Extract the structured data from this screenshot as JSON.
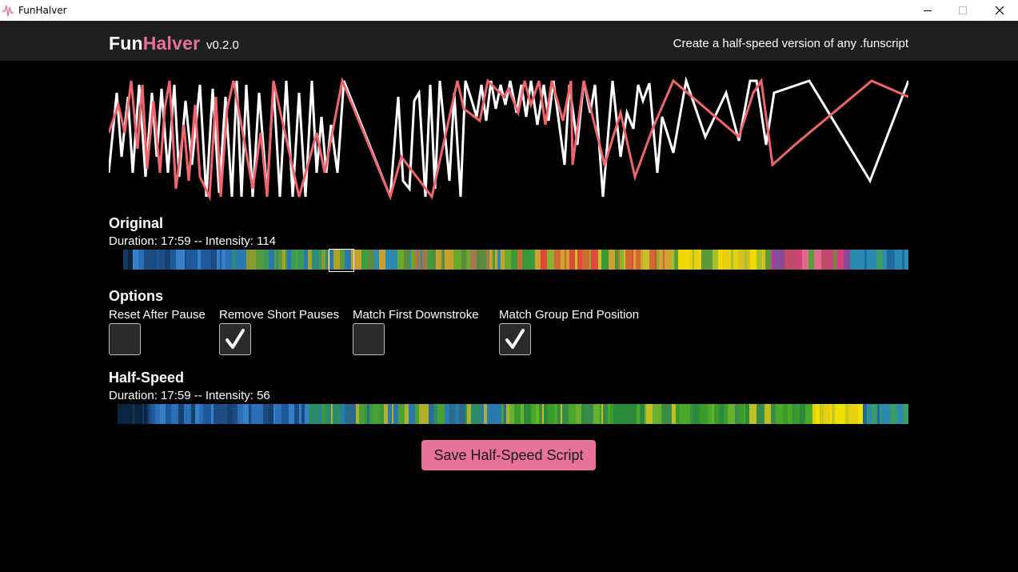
{
  "window": {
    "title": "FunHalver"
  },
  "header": {
    "brand_fun": "Fun",
    "brand_halver": "Halver",
    "version": "v0.2.0",
    "tagline": "Create a half-speed version of any .funscript"
  },
  "original": {
    "title": "Original",
    "stats": "Duration: 17:59 -- Intensity: 114"
  },
  "options": {
    "title": "Options",
    "items": [
      {
        "label": "Reset After Pause",
        "checked": false
      },
      {
        "label": "Remove Short Pauses",
        "checked": true
      },
      {
        "label": "Match First Downstroke",
        "checked": false
      },
      {
        "label": "Match Group End Position",
        "checked": true
      }
    ]
  },
  "half_speed": {
    "title": "Half-Speed",
    "stats": "Duration: 17:59 -- Intensity: 56"
  },
  "save_button": {
    "label": "Save Half-Speed Script"
  },
  "colors": {
    "accent": "#e8729a",
    "original_line": "#ffffff",
    "half_line": "#f0646e",
    "header_bg": "#1f1f1f"
  }
}
